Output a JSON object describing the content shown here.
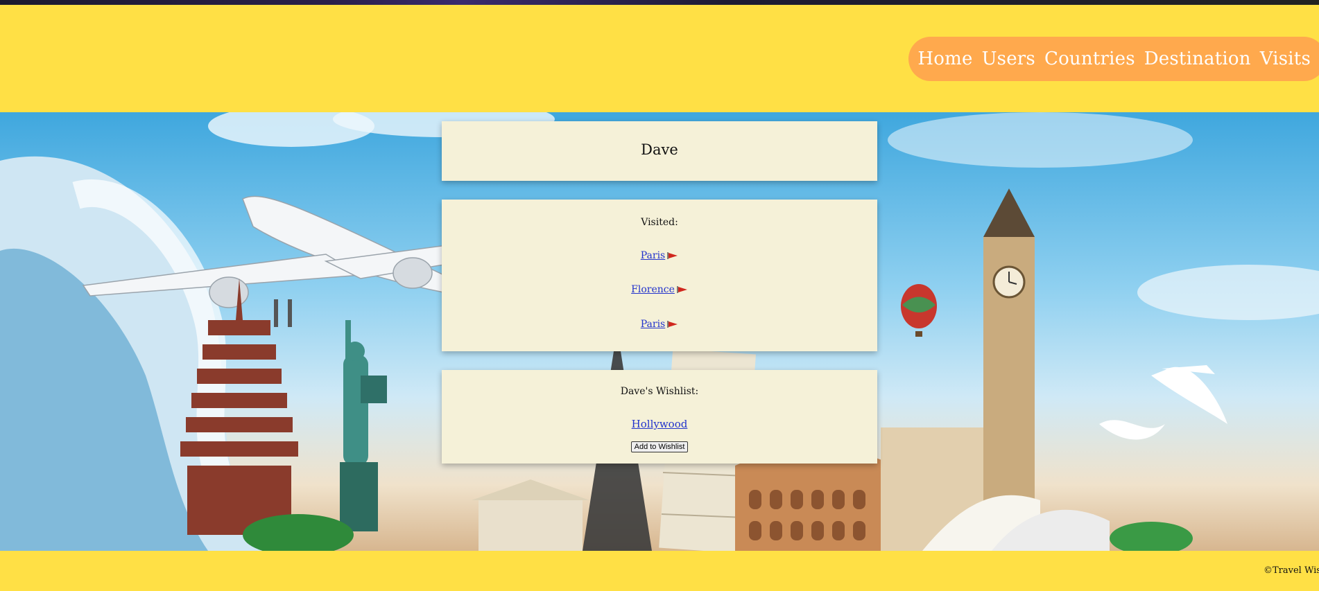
{
  "nav": {
    "items": [
      "Home",
      "Users",
      "Countries",
      "Destination",
      "Visits"
    ]
  },
  "profile": {
    "name": "Dave"
  },
  "visited": {
    "label": "Visited:",
    "items": [
      "Paris",
      "Florence",
      "Paris"
    ],
    "flag_icon": "flag-icon"
  },
  "wishlist": {
    "label": "Dave's Wishlist:",
    "items": [
      "Hollywood"
    ],
    "button_label": "Add to Wishlist"
  },
  "footer": {
    "copyright": "©Travel Wishli"
  },
  "colors": {
    "header": "#ffe045",
    "nav_pill": "#ffa94d",
    "card": "#f5f1d8",
    "link": "#2233cc",
    "flag": "#d0281e"
  }
}
